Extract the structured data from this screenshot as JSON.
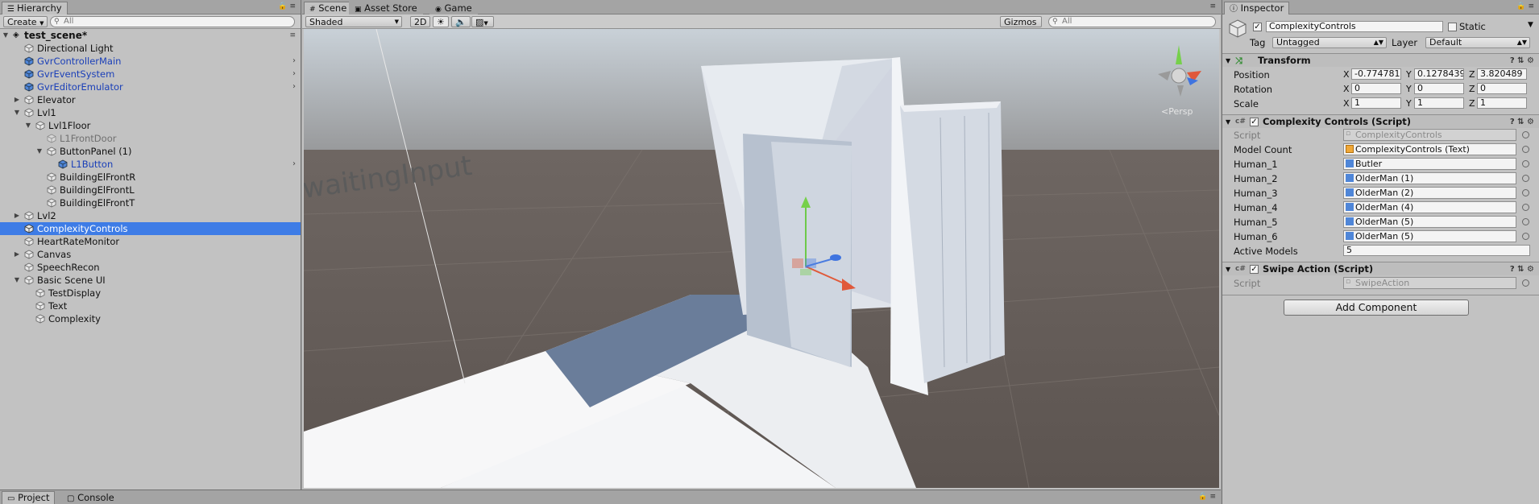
{
  "hierarchy": {
    "tab_label": "Hierarchy",
    "create_label": "Create",
    "search_placeholder": "All",
    "scene_name": "test_scene*",
    "items": [
      {
        "label": "Directional Light"
      },
      {
        "label": "GvrControllerMain"
      },
      {
        "label": "GvrEventSystem"
      },
      {
        "label": "GvrEditorEmulator"
      },
      {
        "label": "Elevator"
      },
      {
        "label": "Lvl1"
      },
      {
        "label": "Lvl1Floor"
      },
      {
        "label": "L1FrontDoor"
      },
      {
        "label": "ButtonPanel (1)"
      },
      {
        "label": "L1Button"
      },
      {
        "label": "BuildingElFrontR"
      },
      {
        "label": "BuildingElFrontL"
      },
      {
        "label": "BuildingElFrontT"
      },
      {
        "label": "Lvl2"
      },
      {
        "label": "ComplexityControls"
      },
      {
        "label": "HeartRateMonitor"
      },
      {
        "label": "Canvas"
      },
      {
        "label": "SpeechRecon"
      },
      {
        "label": "Basic Scene UI"
      },
      {
        "label": "TestDisplay"
      },
      {
        "label": "Text"
      },
      {
        "label": "Complexity"
      }
    ]
  },
  "scene": {
    "tabs": [
      {
        "label": "Scene"
      },
      {
        "label": "Asset Store"
      },
      {
        "label": "Game"
      }
    ],
    "shading_mode": "Shaded",
    "mode_2d": "2D",
    "gizmos_label": "Gizmos",
    "search_placeholder": "All",
    "world_text": "waitingInput",
    "projection_label": "Persp"
  },
  "inspector": {
    "tab_label": "Inspector",
    "object_name": "ComplexityControls",
    "static_label": "Static",
    "tag_label": "Tag",
    "tag_value": "Untagged",
    "layer_label": "Layer",
    "layer_value": "Default",
    "transform": {
      "title": "Transform",
      "position_label": "Position",
      "rotation_label": "Rotation",
      "scale_label": "Scale",
      "axis_x": "X",
      "axis_y": "Y",
      "axis_z": "Z",
      "position": {
        "x": "-0.774781",
        "y": "0.1278439",
        "z": "3.820489"
      },
      "rotation": {
        "x": "0",
        "y": "0",
        "z": "0"
      },
      "scale": {
        "x": "1",
        "y": "1",
        "z": "1"
      }
    },
    "complexity": {
      "title": "Complexity Controls (Script)",
      "script_label": "Script",
      "script_value": "ComplexityControls",
      "model_count_label": "Model Count",
      "model_count_value": "ComplexityControls (Text)",
      "humans": [
        {
          "label": "Human_1",
          "value": "Butler"
        },
        {
          "label": "Human_2",
          "value": "OlderMan (1)"
        },
        {
          "label": "Human_3",
          "value": "OlderMan (2)"
        },
        {
          "label": "Human_4",
          "value": "OlderMan (4)"
        },
        {
          "label": "Human_5",
          "value": "OlderMan (5)"
        },
        {
          "label": "Human_6",
          "value": "OlderMan (5)"
        }
      ],
      "active_models_label": "Active Models",
      "active_models_value": "5"
    },
    "swipe": {
      "title": "Swipe Action (Script)",
      "script_label": "Script",
      "script_value": "SwipeAction"
    },
    "add_component_label": "Add Component"
  },
  "bottom": {
    "tabs": [
      {
        "label": "Project"
      },
      {
        "label": "Console"
      }
    ]
  },
  "colors": {
    "selection": "#3e7ce6",
    "prefab_text": "#1a3fb8",
    "panel_bg": "#c2c2c2",
    "sky_top": "#b7c0c8",
    "ground": "#615853"
  }
}
